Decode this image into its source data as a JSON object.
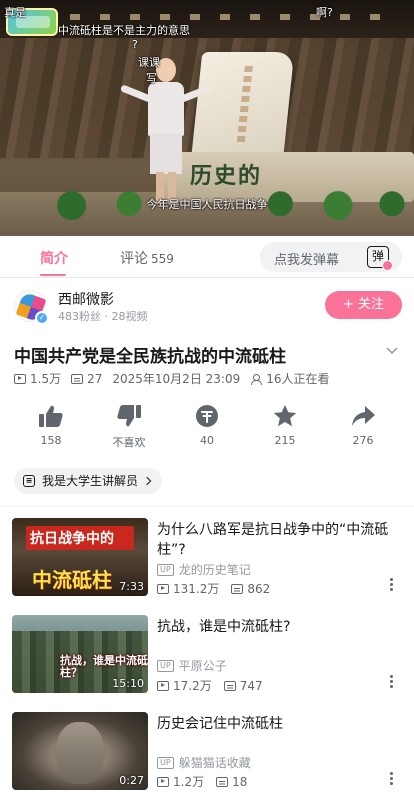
{
  "player": {
    "danmaku": [
      {
        "text": "真是"
      },
      {
        "text": "啊?"
      },
      {
        "text": "中流砥柱是不是主力的意思"
      },
      {
        "text": "?"
      },
      {
        "text": "课课"
      },
      {
        "text": "写"
      }
    ],
    "subtitle": "今年是中国人民抗日战争",
    "monument_text": "历史的"
  },
  "tabs": [
    {
      "label": "简介",
      "active": true
    },
    {
      "label": "评论",
      "count": "559",
      "active": false
    }
  ],
  "danmaku_input": {
    "placeholder": "点我发弹幕",
    "toggle_label": "弹"
  },
  "uploader": {
    "name": "西邮微影",
    "stats": "483粉丝 · 28视频",
    "follow_label": "+ 关注"
  },
  "video": {
    "title": "中国共产党是全民族抗战的中流砥柱",
    "views": "1.5万",
    "danmaku_count": "27",
    "date": "2025年10月2日 23:09",
    "watching": "16人正在看"
  },
  "actions": [
    {
      "name": "like",
      "label": "158"
    },
    {
      "name": "dislike",
      "label": "不喜欢"
    },
    {
      "name": "coin",
      "label": "40"
    },
    {
      "name": "favorite",
      "label": "215"
    },
    {
      "name": "share",
      "label": "276"
    }
  ],
  "tag_chip": {
    "label": "我是大学生讲解员"
  },
  "recommendations": [
    {
      "title": "为什么八路军是抗日战争中的“中流砥柱”?",
      "author": "龙的历史笔记",
      "views": "131.2万",
      "danmaku": "862",
      "duration": "7:33",
      "thumb_banner": "抗日战争中的",
      "thumb_big": "中流砥柱"
    },
    {
      "title": "抗战，谁是中流砥柱?",
      "author": "平原公子",
      "views": "17.2万",
      "danmaku": "747",
      "duration": "15:10",
      "thumb_text": "抗战，谁是中流砥柱？"
    },
    {
      "title": "历史会记住中流砥柱",
      "author": "躲猫猫话收藏",
      "views": "1.2万",
      "danmaku": "18",
      "duration": "0:27"
    }
  ],
  "up_badge": "UP",
  "colors": {
    "accent": "#fb7299",
    "text": "#18191c",
    "muted": "#61666d",
    "light": "#9499a0"
  }
}
